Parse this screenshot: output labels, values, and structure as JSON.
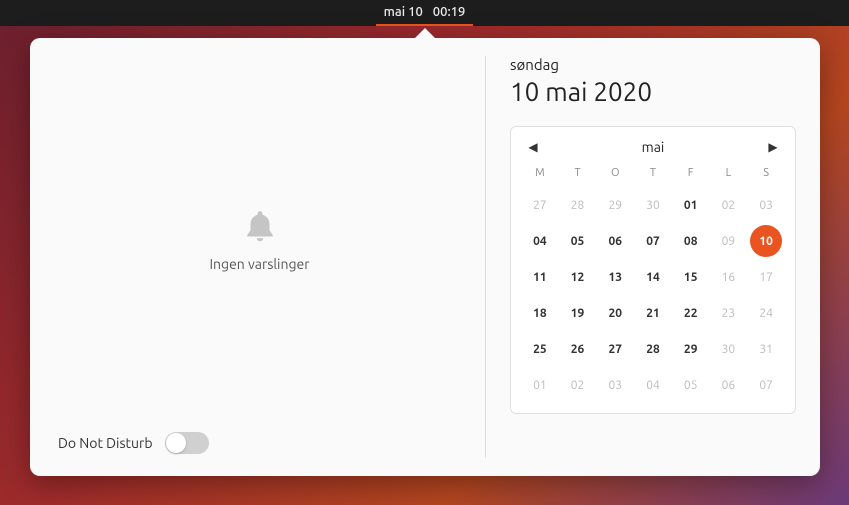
{
  "topbar": {
    "date": "mai 10",
    "time": "00:19"
  },
  "notifications": {
    "empty_text": "Ingen varslinger",
    "dnd_label": "Do Not Disturb"
  },
  "date_header": {
    "weekday": "søndag",
    "full": "10 mai 2020"
  },
  "calendar": {
    "month": "mai",
    "dow": [
      "M",
      "T",
      "O",
      "T",
      "F",
      "L",
      "S"
    ],
    "weeks": [
      [
        {
          "n": "27",
          "o": true
        },
        {
          "n": "28",
          "o": true
        },
        {
          "n": "29",
          "o": true
        },
        {
          "n": "30",
          "o": true
        },
        {
          "n": "01"
        },
        {
          "n": "02",
          "w": true
        },
        {
          "n": "03",
          "w": true
        }
      ],
      [
        {
          "n": "04"
        },
        {
          "n": "05"
        },
        {
          "n": "06"
        },
        {
          "n": "07"
        },
        {
          "n": "08"
        },
        {
          "n": "09",
          "w": true
        },
        {
          "n": "10",
          "t": true
        }
      ],
      [
        {
          "n": "11"
        },
        {
          "n": "12"
        },
        {
          "n": "13"
        },
        {
          "n": "14"
        },
        {
          "n": "15"
        },
        {
          "n": "16",
          "w": true
        },
        {
          "n": "17",
          "w": true
        }
      ],
      [
        {
          "n": "18"
        },
        {
          "n": "19"
        },
        {
          "n": "20"
        },
        {
          "n": "21"
        },
        {
          "n": "22"
        },
        {
          "n": "23",
          "w": true
        },
        {
          "n": "24",
          "w": true
        }
      ],
      [
        {
          "n": "25"
        },
        {
          "n": "26"
        },
        {
          "n": "27"
        },
        {
          "n": "28"
        },
        {
          "n": "29"
        },
        {
          "n": "30",
          "w": true
        },
        {
          "n": "31",
          "w": true
        }
      ],
      [
        {
          "n": "01",
          "o": true
        },
        {
          "n": "02",
          "o": true
        },
        {
          "n": "03",
          "o": true
        },
        {
          "n": "04",
          "o": true
        },
        {
          "n": "05",
          "o": true
        },
        {
          "n": "06",
          "o": true
        },
        {
          "n": "07",
          "o": true
        }
      ]
    ]
  }
}
